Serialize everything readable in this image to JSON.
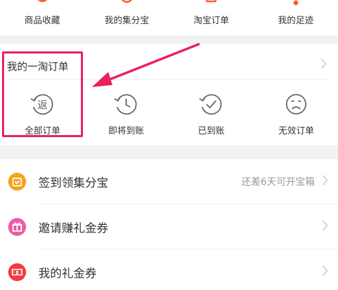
{
  "top_grid": {
    "items": [
      {
        "label": "商品收藏",
        "icon": "favorites-icon"
      },
      {
        "label": "我的集分宝",
        "icon": "points-icon"
      },
      {
        "label": "淘宝订单",
        "icon": "taobao-order-icon"
      },
      {
        "label": "我的足迹",
        "icon": "footprint-icon"
      }
    ]
  },
  "orders": {
    "title": "我的一淘订单",
    "statuses": [
      {
        "label": "全部订单",
        "icon": "return-icon",
        "icon_glyph": "返"
      },
      {
        "label": "即将到账",
        "icon": "clock-icon"
      },
      {
        "label": "已到账",
        "icon": "check-icon"
      },
      {
        "label": "无效订单",
        "icon": "sad-face-icon"
      }
    ]
  },
  "menu": {
    "items": [
      {
        "label": "签到领集分宝",
        "hint": "还差6天可开宝箱",
        "icon": "checkin-icon",
        "color": "#f7a21b"
      },
      {
        "label": "邀请赚礼金券",
        "hint": "",
        "icon": "gift-icon",
        "color": "#f05ba3"
      },
      {
        "label": "我的礼金券",
        "hint": "",
        "icon": "coupon-icon",
        "color": "#f03c3c"
      }
    ]
  },
  "colors": {
    "accent_red": "#e8205b",
    "icon_gray": "#666666",
    "top_icon_orange": "#ff5a2a"
  }
}
